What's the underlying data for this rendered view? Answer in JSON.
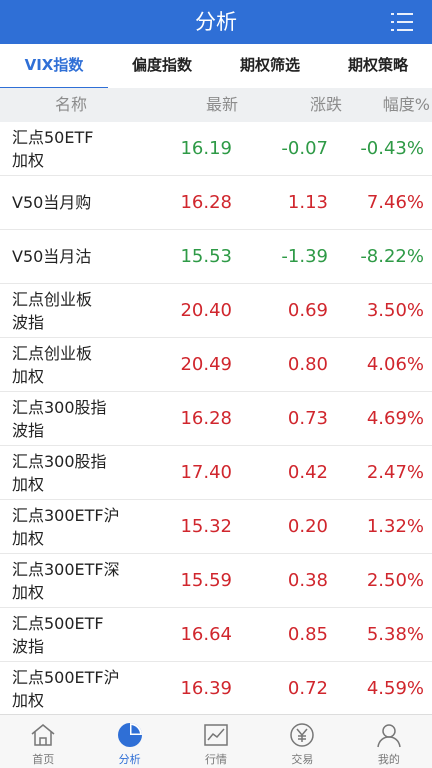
{
  "header": {
    "title": "分析"
  },
  "tabs": [
    {
      "label": "VIX指数",
      "active": true
    },
    {
      "label": "偏度指数",
      "active": false
    },
    {
      "label": "期权筛选",
      "active": false
    },
    {
      "label": "期权策略",
      "active": false
    }
  ],
  "columns": {
    "name": "名称",
    "latest": "最新",
    "change": "涨跌",
    "pct": "幅度%"
  },
  "rows": [
    {
      "name": "汇点50ETF\n加权",
      "latest": "16.19",
      "change": "-0.07",
      "pct": "-0.43%",
      "trend": "down"
    },
    {
      "name": "V50当月购",
      "latest": "16.28",
      "change": "1.13",
      "pct": "7.46%",
      "trend": "up"
    },
    {
      "name": "V50当月沽",
      "latest": "15.53",
      "change": "-1.39",
      "pct": "-8.22%",
      "trend": "down"
    },
    {
      "name": "汇点创业板\n波指",
      "latest": "20.40",
      "change": "0.69",
      "pct": "3.50%",
      "trend": "up"
    },
    {
      "name": "汇点创业板\n加权",
      "latest": "20.49",
      "change": "0.80",
      "pct": "4.06%",
      "trend": "up"
    },
    {
      "name": "汇点300股指\n波指",
      "latest": "16.28",
      "change": "0.73",
      "pct": "4.69%",
      "trend": "up"
    },
    {
      "name": "汇点300股指\n加权",
      "latest": "17.40",
      "change": "0.42",
      "pct": "2.47%",
      "trend": "up"
    },
    {
      "name": "汇点300ETF沪\n加权",
      "latest": "15.32",
      "change": "0.20",
      "pct": "1.32%",
      "trend": "up"
    },
    {
      "name": "汇点300ETF深\n加权",
      "latest": "15.59",
      "change": "0.38",
      "pct": "2.50%",
      "trend": "up"
    },
    {
      "name": "汇点500ETF\n波指",
      "latest": "16.64",
      "change": "0.85",
      "pct": "5.38%",
      "trend": "up"
    },
    {
      "name": "汇点500ETF沪\n加权",
      "latest": "16.39",
      "change": "0.72",
      "pct": "4.59%",
      "trend": "up"
    }
  ],
  "nav": [
    {
      "label": "首页",
      "icon": "home-icon",
      "active": false
    },
    {
      "label": "分析",
      "icon": "pie-chart-icon",
      "active": true
    },
    {
      "label": "行情",
      "icon": "line-chart-icon",
      "active": false
    },
    {
      "label": "交易",
      "icon": "yen-coin-icon",
      "active": false
    },
    {
      "label": "我的",
      "icon": "user-icon",
      "active": false
    }
  ],
  "colors": {
    "brand": "#2f6fd6",
    "up": "#d0262d",
    "down": "#2e9a46"
  }
}
